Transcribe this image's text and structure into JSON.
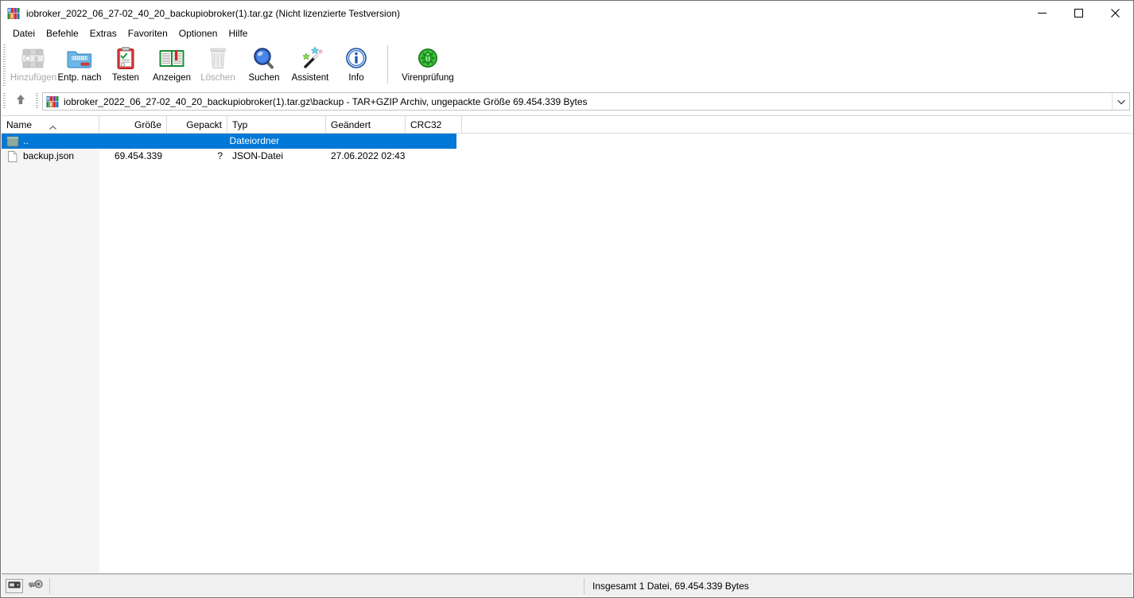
{
  "window": {
    "title": "iobroker_2022_06_27-02_40_20_backupiobroker(1).tar.gz (Nicht lizenzierte Testversion)",
    "app_icon": "winrar-books-icon",
    "minimize_label": "Minimieren",
    "maximize_label": "Maximieren",
    "close_label": "Schließen"
  },
  "menubar": {
    "items": [
      {
        "label": "Datei",
        "name": "menu-datei"
      },
      {
        "label": "Befehle",
        "name": "menu-befehle"
      },
      {
        "label": "Extras",
        "name": "menu-extras"
      },
      {
        "label": "Favoriten",
        "name": "menu-favoriten"
      },
      {
        "label": "Optionen",
        "name": "menu-optionen"
      },
      {
        "label": "Hilfe",
        "name": "menu-hilfe"
      }
    ]
  },
  "toolbar": {
    "buttons": [
      {
        "label": "Hinzufügen",
        "icon": "add-archive-icon",
        "disabled": true
      },
      {
        "label": "Entp. nach",
        "icon": "extract-folder-icon",
        "disabled": false
      },
      {
        "label": "Testen",
        "icon": "test-clipboard-icon",
        "disabled": false
      },
      {
        "label": "Anzeigen",
        "icon": "view-book-icon",
        "disabled": false
      },
      {
        "label": "Löschen",
        "icon": "delete-trash-icon",
        "disabled": true
      },
      {
        "label": "Suchen",
        "icon": "search-magnifier-icon",
        "disabled": false
      },
      {
        "label": "Assistent",
        "icon": "wizard-wand-icon",
        "disabled": false
      },
      {
        "label": "Info",
        "icon": "info-circle-icon",
        "disabled": false
      }
    ],
    "virus_button": {
      "label": "Virenprüfung",
      "icon": "virus-scan-bug-icon",
      "disabled": false
    }
  },
  "addressbar": {
    "up_icon": "arrow-up-icon",
    "archive_icon": "winrar-books-icon",
    "path": "iobroker_2022_06_27-02_40_20_backupiobroker(1).tar.gz\\backup - TAR+GZIP Archiv, ungepackte Größe 69.454.339 Bytes",
    "dropdown_icon": "chevron-down-icon"
  },
  "filelist": {
    "sort_column": "Name",
    "sort_direction": "ascending",
    "sort_icon": "sort-ascending-caret-icon",
    "columns": [
      {
        "label": "Name",
        "align": "left"
      },
      {
        "label": "Größe",
        "align": "right"
      },
      {
        "label": "Gepackt",
        "align": "right"
      },
      {
        "label": "Typ",
        "align": "left"
      },
      {
        "label": "Geändert",
        "align": "left"
      },
      {
        "label": "CRC32",
        "align": "left"
      }
    ],
    "rows": [
      {
        "name": "..",
        "size": "",
        "packed": "",
        "type": "Dateiordner",
        "modified": "",
        "crc32": "",
        "icon": "folder-up-icon",
        "selected": true
      },
      {
        "name": "backup.json",
        "size": "69.454.339",
        "packed": "?",
        "type": "JSON-Datei",
        "modified": "27.06.2022 02:43",
        "crc32": "",
        "icon": "file-document-icon",
        "selected": false
      }
    ]
  },
  "statusbar": {
    "disk_icon": "disk-drive-icon",
    "key_icon": "key-icon",
    "summary": "Insgesamt 1 Datei, 69.454.339 Bytes"
  },
  "colors": {
    "selection": "#0078d7",
    "window_bg": "#ffffff",
    "statusbar_bg": "#f0f0f0",
    "sorted_column_bg": "#f5f5f5",
    "border": "#707070"
  }
}
